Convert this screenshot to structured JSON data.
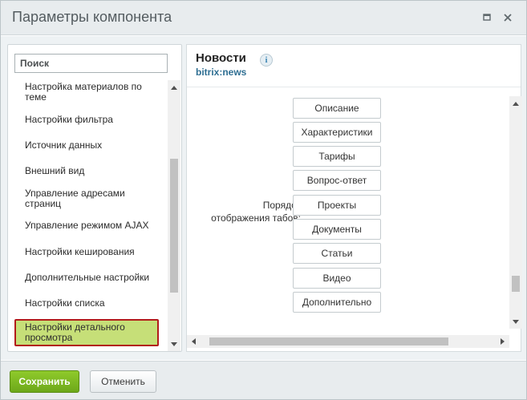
{
  "dialog": {
    "title": "Параметры компонента",
    "window_controls": [
      "maximize-icon",
      "close-icon"
    ]
  },
  "sidebar": {
    "search_placeholder": "Поиск",
    "items": [
      {
        "label": "Настройка материалов по теме"
      },
      {
        "label": "Настройки фильтра"
      },
      {
        "label": "Источник данных"
      },
      {
        "label": "Внешний вид"
      },
      {
        "label": "Управление адресами страниц"
      },
      {
        "label": "Управление режимом AJAX"
      },
      {
        "label": "Настройки кеширования"
      },
      {
        "label": "Дополнительные настройки"
      },
      {
        "label": "Настройки списка"
      },
      {
        "label": "Настройки детального просмотра",
        "selected": true
      }
    ]
  },
  "component": {
    "name": "Новости",
    "code": "bitrix:news",
    "info_icon": "i"
  },
  "property": {
    "label": "Порядок отображения табов:",
    "tabs": [
      "Описание",
      "Характеристики",
      "Тарифы",
      "Вопрос-ответ",
      "Проекты",
      "Документы",
      "Статьи",
      "Видео",
      "Дополнительно"
    ]
  },
  "footer": {
    "save_label": "Сохранить",
    "cancel_label": "Отменить"
  },
  "colors": {
    "save_button": "#7cb71f",
    "selected_item_bg": "#c6df78",
    "selected_item_border": "#b21b1b",
    "component_code": "#2f6f93"
  }
}
